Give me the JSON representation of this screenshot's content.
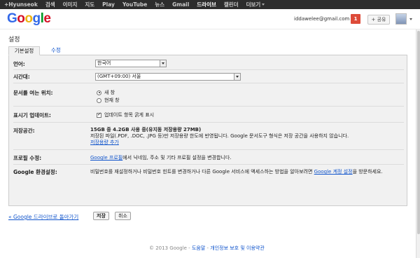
{
  "topbar": {
    "items": [
      {
        "label": "+Hyunseok",
        "active": false
      },
      {
        "label": "검색",
        "active": false
      },
      {
        "label": "이미지",
        "active": false
      },
      {
        "label": "지도",
        "active": false
      },
      {
        "label": "Play",
        "active": false
      },
      {
        "label": "YouTube",
        "active": false
      },
      {
        "label": "뉴스",
        "active": false
      },
      {
        "label": "Gmail",
        "active": false
      },
      {
        "label": "드라이브",
        "active": true
      },
      {
        "label": "캘린더",
        "active": false
      }
    ],
    "more_label": "더보기"
  },
  "header": {
    "logo_letters": [
      "G",
      "o",
      "o",
      "g",
      "l",
      "e"
    ],
    "logo_colors": [
      "#3369e8",
      "#d50f25",
      "#eeb211",
      "#3369e8",
      "#009925",
      "#d50f25"
    ],
    "account_email": "iddawelee@gmail.com",
    "notification_count": "1",
    "share_label": "+ 공유"
  },
  "page": {
    "title": "설정",
    "tabs": [
      {
        "label": "기본설정",
        "active": true
      },
      {
        "label": "수정",
        "active": false
      }
    ]
  },
  "settings": {
    "language": {
      "label": "언어:",
      "value": "한국어"
    },
    "timezone": {
      "label": "시간대:",
      "value": "(GMT+09:00) 서울"
    },
    "open_docs": {
      "label": "문서를 여는 위치:",
      "options": [
        {
          "label": "새 창",
          "selected": true
        },
        {
          "label": "현재 창",
          "selected": false
        }
      ]
    },
    "display_updates": {
      "label": "표시기 업데이트:",
      "checkbox_label": "업데이트 항목 굵게 표시",
      "checked": true
    },
    "storage": {
      "label": "저장공간:",
      "summary": "15GB 중 4.2GB 사용 중(유지동 저장용량 27MB)",
      "description": "저장된 파일(.PDF, .DOC, .JPG 등)만 저장용량 한도에 반영됩니다. Google 문서도구 형식은 저장 공간을 사용하지 않습니다.",
      "link": "저장용량 추가"
    },
    "profile": {
      "label": "프로필 수정:",
      "link": "Google 프로필",
      "text": "에서 닉네임, 주소 및 기타 프로필 설정을 변경합니다."
    },
    "account": {
      "label": "Google 환경설정:",
      "text1": "비밀번호를 재설정하거나 비밀번호 힌트를 변경하거나 다른 Google 서비스에 액세스하는 방법을 알아보려면",
      "link": "Google 계정 설정",
      "text2": "을 방문하세요."
    }
  },
  "actions": {
    "back_link": "« Google 드라이브로 돌아가기",
    "save": "저장",
    "cancel": "취소"
  },
  "footer": {
    "copyright": "© 2013 Google - ",
    "help": "도움말",
    "sep1": " - ",
    "privacy": "개인정보 보호 및 이용약관"
  }
}
